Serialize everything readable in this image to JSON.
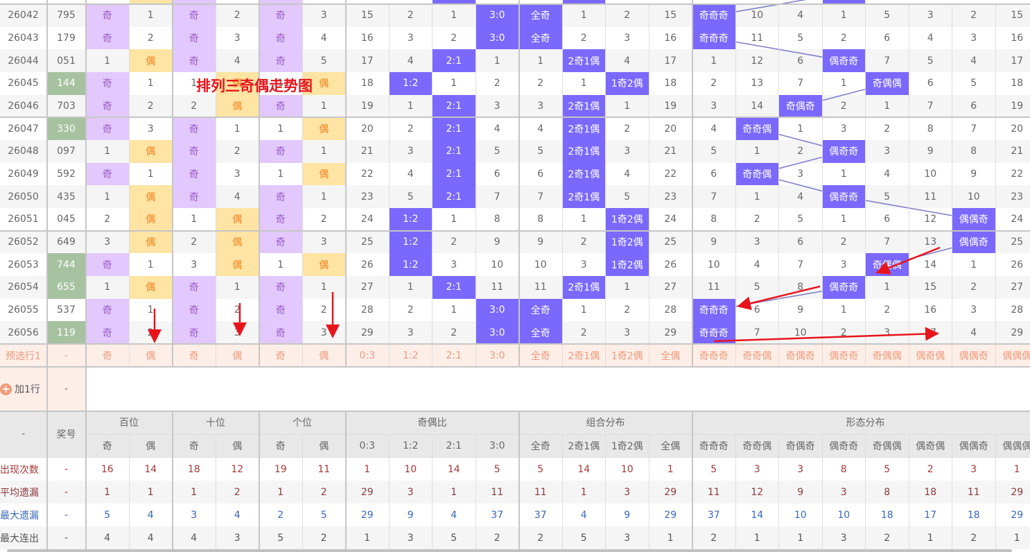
{
  "title": "排列三奇偶走势图",
  "colors": {
    "odd_bg": "#e2c8fc",
    "even_bg": "#ffe4a3",
    "hit": "#7b68fe",
    "pair": "#a6c2a0",
    "trend_line": "#8080c8",
    "annotation": "#e8141c"
  },
  "partial_row": {
    "hits": [
      1,
      2,
      4,
      8,
      11,
      17
    ]
  },
  "rows": [
    {
      "issue": "26042",
      "number": "795",
      "pair": false,
      "cells": [
        "奇",
        "1",
        "奇",
        "2",
        "奇",
        "3",
        "15",
        "2",
        "1",
        "3:0",
        "全奇",
        "1",
        "2",
        "15",
        "奇奇奇",
        "10",
        "4",
        "1",
        "5",
        "3",
        "2",
        "15"
      ]
    },
    {
      "issue": "26043",
      "number": "179",
      "pair": false,
      "cells": [
        "奇",
        "2",
        "奇",
        "3",
        "奇",
        "4",
        "16",
        "3",
        "2",
        "3:0",
        "全奇",
        "2",
        "3",
        "16",
        "奇奇奇",
        "11",
        "5",
        "2",
        "6",
        "4",
        "3",
        "16"
      ]
    },
    {
      "issue": "26044",
      "number": "051",
      "pair": false,
      "cells": [
        "1",
        "偶",
        "奇",
        "4",
        "奇",
        "5",
        "17",
        "4",
        "2:1",
        "1",
        "1",
        "2奇1偶",
        "4",
        "17",
        "1",
        "12",
        "6",
        "偶奇奇",
        "7",
        "5",
        "4",
        "17"
      ]
    },
    {
      "issue": "26045",
      "number": "144",
      "pair": true,
      "cells": [
        "奇",
        "1",
        "1",
        "偶",
        "1",
        "偶",
        "18",
        "1:2",
        "1",
        "2",
        "2",
        "1",
        "1奇2偶",
        "18",
        "2",
        "13",
        "7",
        "1",
        "奇偶偶",
        "6",
        "5",
        "18"
      ]
    },
    {
      "issue": "26046",
      "number": "703",
      "pair": false,
      "cells": [
        "奇",
        "2",
        "2",
        "偶",
        "奇",
        "1",
        "19",
        "1",
        "2:1",
        "3",
        "3",
        "2奇1偶",
        "1",
        "19",
        "3",
        "14",
        "奇偶奇",
        "2",
        "1",
        "7",
        "6",
        "19"
      ]
    },
    {
      "issue": "26047",
      "number": "330",
      "pair": true,
      "cells": [
        "奇",
        "3",
        "奇",
        "1",
        "1",
        "偶",
        "20",
        "2",
        "2:1",
        "4",
        "4",
        "2奇1偶",
        "2",
        "20",
        "4",
        "奇奇偶",
        "1",
        "3",
        "2",
        "8",
        "7",
        "20"
      ]
    },
    {
      "issue": "26048",
      "number": "097",
      "pair": false,
      "cells": [
        "1",
        "偶",
        "奇",
        "2",
        "奇",
        "1",
        "21",
        "3",
        "2:1",
        "5",
        "5",
        "2奇1偶",
        "3",
        "21",
        "5",
        "1",
        "2",
        "偶奇奇",
        "3",
        "9",
        "8",
        "21"
      ]
    },
    {
      "issue": "26049",
      "number": "592",
      "pair": false,
      "cells": [
        "奇",
        "1",
        "奇",
        "3",
        "1",
        "偶",
        "22",
        "4",
        "2:1",
        "6",
        "6",
        "2奇1偶",
        "4",
        "22",
        "6",
        "奇奇偶",
        "3",
        "1",
        "4",
        "10",
        "9",
        "22"
      ]
    },
    {
      "issue": "26050",
      "number": "435",
      "pair": false,
      "cells": [
        "1",
        "偶",
        "奇",
        "4",
        "奇",
        "1",
        "23",
        "5",
        "2:1",
        "7",
        "7",
        "2奇1偶",
        "5",
        "23",
        "7",
        "1",
        "4",
        "偶奇奇",
        "5",
        "11",
        "10",
        "23"
      ]
    },
    {
      "issue": "26051",
      "number": "045",
      "pair": false,
      "cells": [
        "2",
        "偶",
        "1",
        "偶",
        "奇",
        "2",
        "24",
        "1:2",
        "1",
        "8",
        "8",
        "1",
        "1奇2偶",
        "24",
        "8",
        "2",
        "5",
        "1",
        "6",
        "12",
        "偶偶奇",
        "24"
      ]
    },
    {
      "issue": "26052",
      "number": "649",
      "pair": false,
      "cells": [
        "3",
        "偶",
        "2",
        "偶",
        "奇",
        "3",
        "25",
        "1:2",
        "2",
        "9",
        "9",
        "2",
        "1奇2偶",
        "25",
        "9",
        "3",
        "6",
        "2",
        "7",
        "13",
        "偶偶奇",
        "25"
      ]
    },
    {
      "issue": "26053",
      "number": "744",
      "pair": true,
      "cells": [
        "奇",
        "1",
        "3",
        "偶",
        "1",
        "偶",
        "26",
        "1:2",
        "3",
        "10",
        "10",
        "3",
        "1奇2偶",
        "26",
        "10",
        "4",
        "7",
        "3",
        "奇偶偶",
        "14",
        "1",
        "26"
      ]
    },
    {
      "issue": "26054",
      "number": "655",
      "pair": true,
      "cells": [
        "1",
        "偶",
        "奇",
        "1",
        "奇",
        "1",
        "27",
        "1",
        "2:1",
        "11",
        "11",
        "2奇1偶",
        "1",
        "27",
        "11",
        "5",
        "8",
        "偶奇奇",
        "1",
        "15",
        "2",
        "27"
      ]
    },
    {
      "issue": "26055",
      "number": "537",
      "pair": false,
      "cells": [
        "奇",
        "1",
        "奇",
        "2",
        "奇",
        "2",
        "28",
        "2",
        "1",
        "3:0",
        "全奇",
        "1",
        "2",
        "28",
        "奇奇奇",
        "6",
        "9",
        "1",
        "2",
        "16",
        "3",
        "28"
      ]
    },
    {
      "issue": "26056",
      "number": "119",
      "pair": true,
      "cells": [
        "奇",
        "2",
        "奇",
        "3",
        "奇",
        "3",
        "29",
        "3",
        "2",
        "3:0",
        "全奇",
        "2",
        "3",
        "29",
        "奇奇奇",
        "7",
        "10",
        "2",
        "3",
        "17",
        "4",
        "29"
      ]
    }
  ],
  "preselect": {
    "label": "预选行1",
    "number": "-",
    "cells": [
      "奇",
      "偶",
      "奇",
      "偶",
      "奇",
      "偶",
      "0:3",
      "1:2",
      "2:1",
      "3:0",
      "全奇",
      "2奇1偶",
      "1奇2偶",
      "全偶",
      "奇奇奇",
      "奇奇偶",
      "奇偶奇",
      "偶奇奇",
      "奇偶偶",
      "偶奇偶",
      "偶偶奇",
      "偶偶偶"
    ]
  },
  "add_row": {
    "label": "加1行",
    "number": "-"
  },
  "header": {
    "corner": "-",
    "number": "奖号",
    "groups": [
      {
        "label": "百位",
        "span": 2
      },
      {
        "label": "十位",
        "span": 2
      },
      {
        "label": "个位",
        "span": 2
      },
      {
        "label": "奇偶比",
        "span": 4
      },
      {
        "label": "组合分布",
        "span": 4
      },
      {
        "label": "形态分布",
        "span": 8
      }
    ],
    "sub": [
      "奇",
      "偶",
      "奇",
      "偶",
      "奇",
      "偶",
      "0:3",
      "1:2",
      "2:1",
      "3:0",
      "全奇",
      "2奇1偶",
      "1奇2偶",
      "全偶",
      "奇奇奇",
      "奇奇偶",
      "奇偶奇",
      "偶奇奇",
      "奇偶偶",
      "偶奇偶",
      "偶偶奇",
      "偶偶偶"
    ]
  },
  "stats": [
    {
      "label": "出现次数",
      "number": "-",
      "values": [
        "16",
        "14",
        "18",
        "12",
        "19",
        "11",
        "1",
        "10",
        "14",
        "5",
        "5",
        "14",
        "10",
        "1",
        "5",
        "3",
        "3",
        "8",
        "5",
        "2",
        "3",
        "1"
      ]
    },
    {
      "label": "平均遗漏",
      "number": "-",
      "values": [
        "1",
        "1",
        "1",
        "2",
        "1",
        "2",
        "29",
        "3",
        "1",
        "11",
        "11",
        "1",
        "3",
        "29",
        "11",
        "12",
        "9",
        "3",
        "8",
        "18",
        "11",
        "29"
      ]
    },
    {
      "label": "最大遗漏",
      "number": "-",
      "values": [
        "5",
        "4",
        "3",
        "4",
        "2",
        "5",
        "29",
        "9",
        "4",
        "37",
        "37",
        "4",
        "9",
        "29",
        "37",
        "14",
        "10",
        "10",
        "18",
        "17",
        "18",
        "29"
      ]
    },
    {
      "label": "最大连出",
      "number": "-",
      "values": [
        "4",
        "4",
        "4",
        "3",
        "5",
        "2",
        "1",
        "3",
        "5",
        "2",
        "2",
        "5",
        "3",
        "1",
        "2",
        "1",
        "1",
        "3",
        "2",
        "1",
        "2",
        "1"
      ]
    }
  ]
}
